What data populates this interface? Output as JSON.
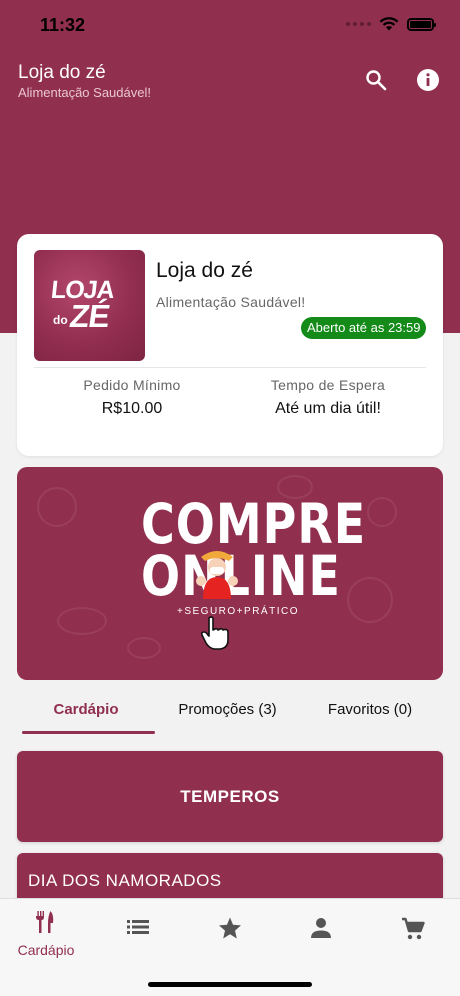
{
  "status_bar": {
    "time": "11:32"
  },
  "header": {
    "title": "Loja do zé",
    "subtitle": "Alimentação Saudável!"
  },
  "store": {
    "logo_text": {
      "line1": "LOJA",
      "do": "do",
      "ze": "ZÉ"
    },
    "name": "Loja do zé",
    "tagline": "Alimentação Saudável!",
    "open_badge": "Aberto até as 23:59",
    "min_order_label": "Pedido Mínimo",
    "min_order_value": "R$10.00",
    "wait_label": "Tempo de Espera",
    "wait_value": "Até um dia útil!"
  },
  "banner": {
    "line1": "COMPRE",
    "line2": "ONLINE",
    "tagline": "+SEGURO+PRÁTICO"
  },
  "tabs": [
    {
      "label": "Cardápio",
      "active": true
    },
    {
      "label": "Promoções (3)",
      "active": false
    },
    {
      "label": "Favoritos (0)",
      "active": false
    }
  ],
  "categories": [
    {
      "label": "TEMPEROS"
    },
    {
      "label": "DIA DOS NAMORADOS"
    }
  ],
  "bottom_nav": [
    {
      "icon": "utensils-icon",
      "label": "Cardápio",
      "active": true
    },
    {
      "icon": "list-icon",
      "label": ""
    },
    {
      "icon": "star-icon",
      "label": ""
    },
    {
      "icon": "person-icon",
      "label": ""
    },
    {
      "icon": "cart-icon",
      "label": ""
    }
  ],
  "colors": {
    "brand": "#912f4f",
    "open_badge": "#148b19",
    "background": "#f2f2f2"
  }
}
